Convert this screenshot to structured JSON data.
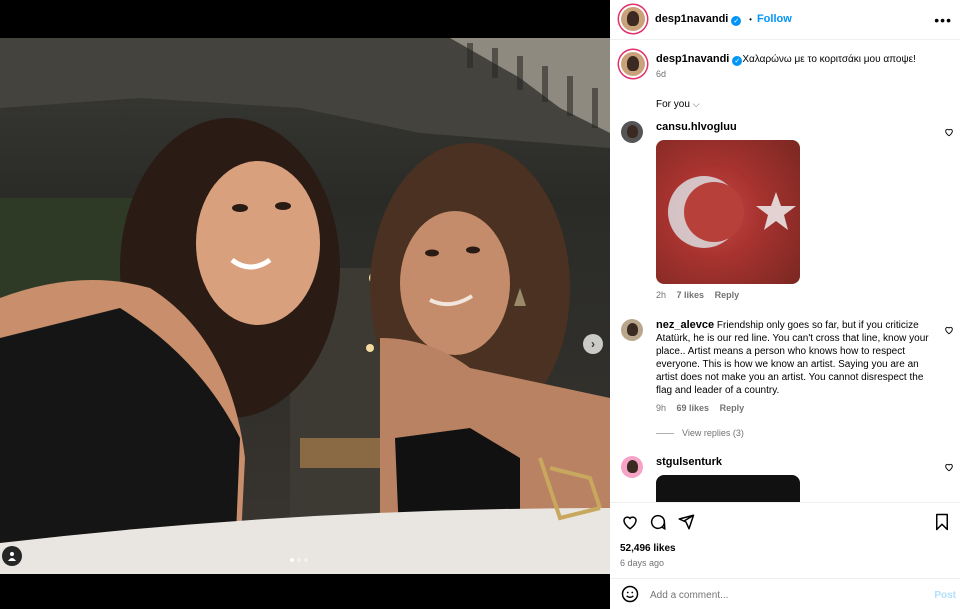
{
  "post": {
    "username": "desp1navandi",
    "follow_label": "Follow",
    "dot_sep": "•",
    "more_label": "•••",
    "caption": "Χαλαρώνω με το κοριτσάκι μου αποψε!",
    "caption_age": "6d",
    "likes": "52,496 likes",
    "posted_ago": "6 days ago",
    "carousel_count": 3,
    "carousel_active": 1
  },
  "comments_filter": {
    "label": "For you",
    "chevron": "⌵"
  },
  "comments": [
    {
      "username": "cansu.hlvogluu",
      "text": "",
      "age": "2h",
      "likes": "7 likes",
      "reply": "Reply"
    },
    {
      "username": "nez_alevce",
      "text": "Friendship only goes so far, but if you criticize Atatürk, he is our red line. You can't cross that line, know your place.. Artist means a person who knows how to respect everyone. This is how we know an artist. Saying you are an artist does not make you an artist. You cannot disrespect the flag and leader of a country.",
      "age": "9h",
      "likes": "69 likes",
      "reply": "Reply",
      "view_replies": "View replies (3)"
    },
    {
      "username": "stgulsenturk",
      "text": ""
    }
  ],
  "add_comment": {
    "placeholder": "Add a comment...",
    "post_label": "Post"
  },
  "icons": {
    "heart": "heart-icon",
    "comment": "comment-icon",
    "share": "share-icon",
    "bookmark": "bookmark-icon",
    "emoji": "emoji-icon",
    "user_tag": "user-tag-icon",
    "next": "chevron-right-icon",
    "verified": "verified-badge-icon",
    "more": "more-options-icon"
  },
  "colors": {
    "accent": "#0095f6",
    "muted": "#737373",
    "post_disabled": "#b2dffc"
  }
}
